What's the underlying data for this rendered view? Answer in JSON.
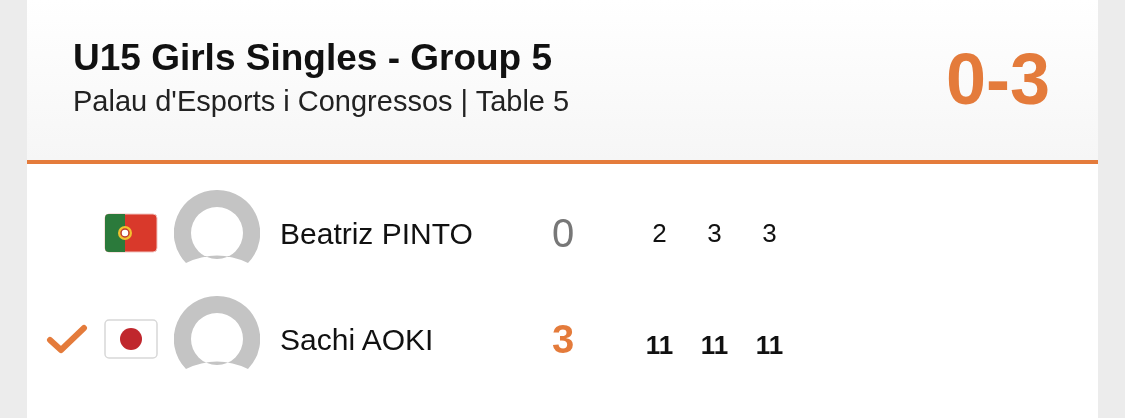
{
  "match": {
    "title": "U15 Girls Singles - Group 5",
    "venue": "Palau d'Esports i Congressos | Table 5",
    "score": "0-3"
  },
  "players": [
    {
      "name": "Beatriz PINTO",
      "kind": "portugal",
      "winner": false,
      "games": "0",
      "sets": [
        "2",
        "3",
        "3"
      ]
    },
    {
      "name": "Sachi AOKI",
      "kind": "japan",
      "winner": true,
      "games": "3",
      "sets": [
        "11",
        "11",
        "11"
      ]
    }
  ]
}
